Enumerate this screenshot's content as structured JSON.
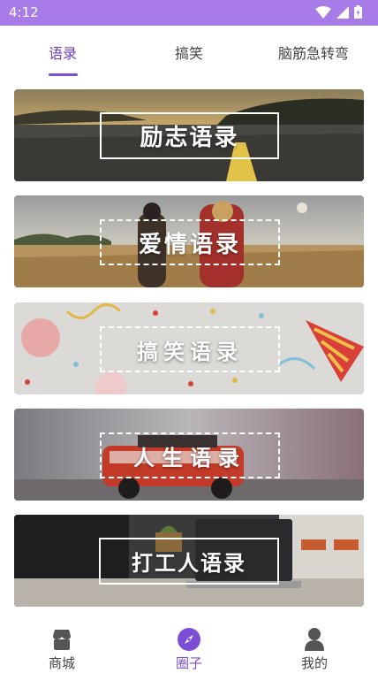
{
  "status_bar": {
    "time": "4:12"
  },
  "tabs": [
    {
      "label": "语录",
      "active": true
    },
    {
      "label": "搞笑",
      "active": false
    },
    {
      "label": "脑筋急转弯",
      "active": false
    }
  ],
  "cards": [
    {
      "title": "励志语录",
      "theme": "road-sunset"
    },
    {
      "title": "爱情语录",
      "theme": "couple-field"
    },
    {
      "title": "搞笑语录",
      "theme": "party"
    },
    {
      "title": "人生语录",
      "theme": "toy-car"
    },
    {
      "title": "打工人语录",
      "theme": "laptop-desk"
    }
  ],
  "bottom_nav": [
    {
      "label": "商城",
      "icon": "shop-icon",
      "active": false
    },
    {
      "label": "圈子",
      "icon": "compass-icon",
      "active": true
    },
    {
      "label": "我的",
      "icon": "user-icon",
      "active": false
    }
  ],
  "colors": {
    "accent": "#7b4ed6",
    "status_bar": "#a87ce8"
  }
}
